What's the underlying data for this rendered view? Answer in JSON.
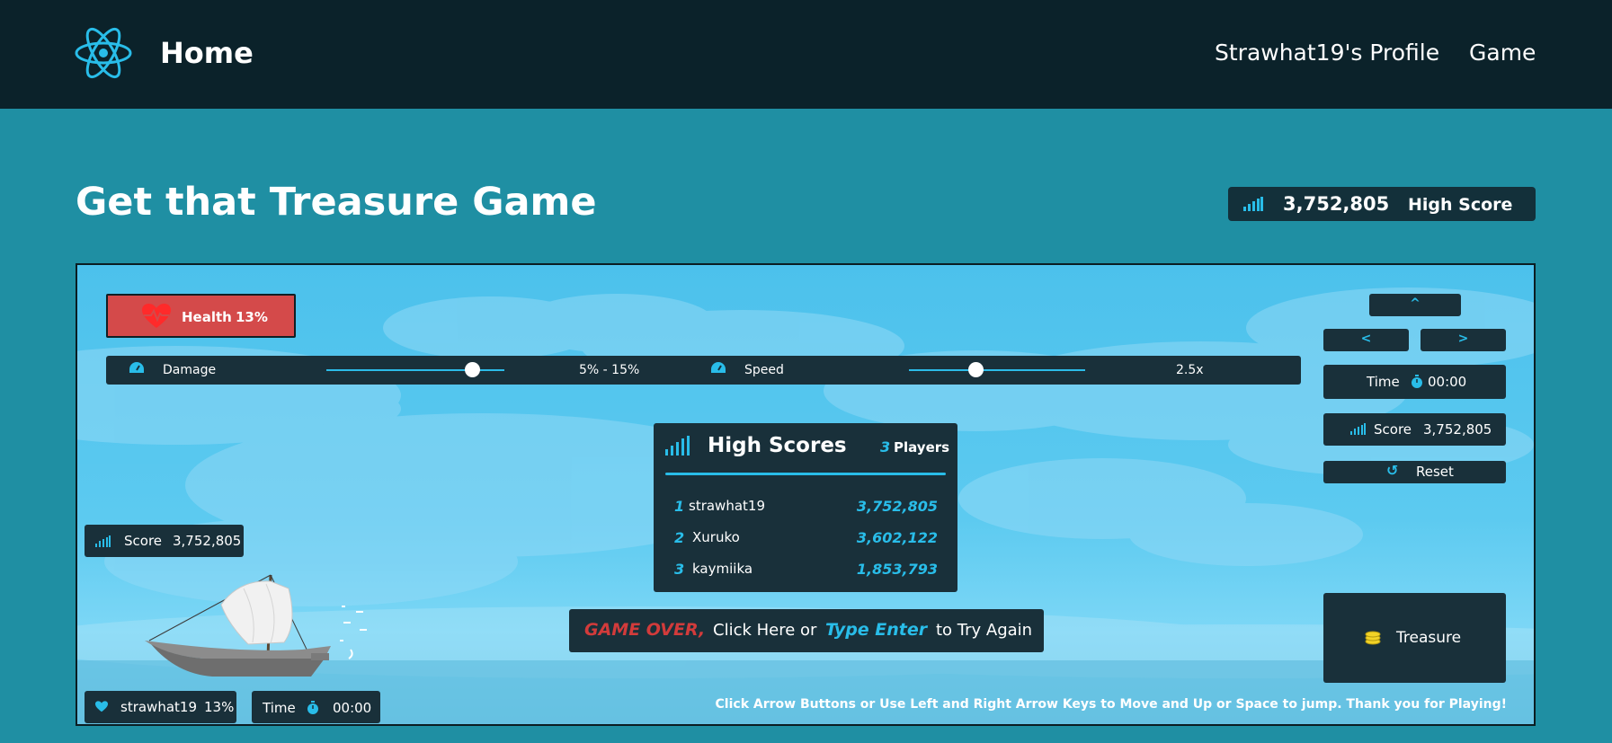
{
  "nav": {
    "home": "Home",
    "profile": "Strawhat19's Profile",
    "game": "Game",
    "logo_icon": "react-atom-icon"
  },
  "page_title": "Get that Treasure Game",
  "high_score_top": {
    "value": "3,752,805",
    "label": "High Score"
  },
  "game": {
    "health": {
      "label": "Health",
      "percent": "13%"
    },
    "damage": {
      "label": "Damage",
      "value": "5% - 15%",
      "level": 0.82
    },
    "speed": {
      "label": "Speed",
      "value": "2.5x",
      "level": 0.38
    },
    "controls": {
      "up": "^",
      "left": "<",
      "right": ">"
    },
    "time": {
      "label": "Time",
      "value": "00:00"
    },
    "score": {
      "label": "Score",
      "value": "3,752,805"
    },
    "reset_label": "Reset",
    "treasure_label": "Treasure",
    "high_scores": {
      "title": "High Scores",
      "count": "3",
      "count_label": "Players",
      "rows": [
        {
          "rank": "1",
          "name": "strawhat19",
          "score": "3,752,805"
        },
        {
          "rank": "2",
          "name": "Xuruko",
          "score": "3,602,122"
        },
        {
          "rank": "3",
          "name": "kaymiika",
          "score": "1,853,793"
        }
      ]
    },
    "game_over": {
      "go": "GAME OVER,",
      "t1": "Click Here or",
      "type_enter": "Type Enter",
      "t2": "to Try Again"
    },
    "player": {
      "name": "strawhat19",
      "percent": "13%"
    },
    "instructions": "Click Arrow Buttons or Use Left and Right Arrow Keys to Move and Up or Space to jump. Thank you for Playing!"
  },
  "colors": {
    "accent": "#29bde9",
    "health": "#d44a4a",
    "panel": "#19303a",
    "nav": "#0b222a",
    "page": "#1f8fa3"
  }
}
